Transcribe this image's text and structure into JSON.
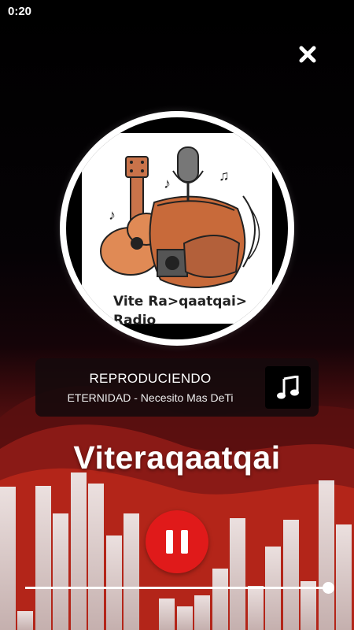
{
  "status_bar": {
    "time": "0:20"
  },
  "close": {
    "icon": "close-icon"
  },
  "cover": {
    "line1": "Vite Ra>qaatqai>",
    "line2": "Radio"
  },
  "now_playing": {
    "status": "REPRODUCIENDO",
    "track": "ETERNIDAD - Necesito Mas DeTi",
    "icon": "music-note-icon"
  },
  "station": {
    "name": "Viteraqaatqai"
  },
  "player": {
    "state": "playing",
    "progress": 1.0,
    "accent": "#e01a1a"
  }
}
